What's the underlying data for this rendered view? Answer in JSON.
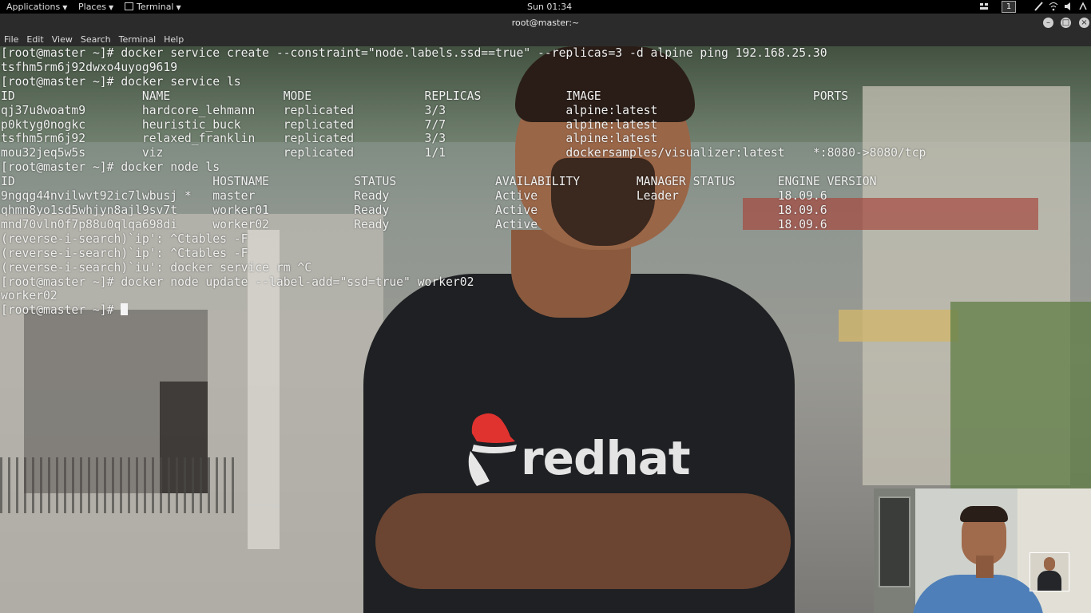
{
  "topbar": {
    "applications": "Applications",
    "places": "Places",
    "terminal": "Terminal",
    "clock": "Sun 01:34",
    "workspace": "1"
  },
  "window": {
    "title": "root@master:~"
  },
  "menubar": [
    "File",
    "Edit",
    "View",
    "Search",
    "Terminal",
    "Help"
  ],
  "terminal": {
    "lines": [
      "[root@master ~]# docker service create --constraint=\"node.labels.ssd==true\" --replicas=3 -d alpine ping 192.168.25.30",
      "tsfhm5rm6j92dwxo4uyog9619",
      "[root@master ~]# docker service ls",
      "ID                  NAME                MODE                REPLICAS            IMAGE                              PORTS",
      "qj37u8woatm9        hardcore_lehmann    replicated          3/3                 alpine:latest",
      "p0ktyg0nogkc        heuristic_buck      replicated          7/7                 alpine:latest",
      "tsfhm5rm6j92        relaxed_franklin    replicated          3/3                 alpine:latest",
      "mou32jeq5w5s        viz                 replicated          1/1                 dockersamples/visualizer:latest    *:8080->8080/tcp",
      "[root@master ~]# docker node ls",
      "ID                            HOSTNAME            STATUS              AVAILABILITY        MANAGER STATUS      ENGINE VERSION",
      "9ngqg44nvilwvt92ic7lwbusj *   master              Ready               Active              Leader              18.09.6",
      "qhmn8yo1sd5whjyn8ajl9sv7t     worker01            Ready               Active                                  18.09.6",
      "mnd70vln0f7p88u0qlqa698di     worker02            Ready               Active                                  18.09.6",
      "(reverse-i-search)`ip': ^Ctables -F",
      "(reverse-i-search)`ip': ^Ctables -F",
      "(reverse-i-search)`iu': docker service rm ^C",
      "[root@master ~]# docker node update --label-add=\"ssd=true\" worker02",
      "worker02"
    ],
    "prompt": "[root@master ~]# "
  },
  "background": {
    "shirt_logo_text": "redhat"
  }
}
